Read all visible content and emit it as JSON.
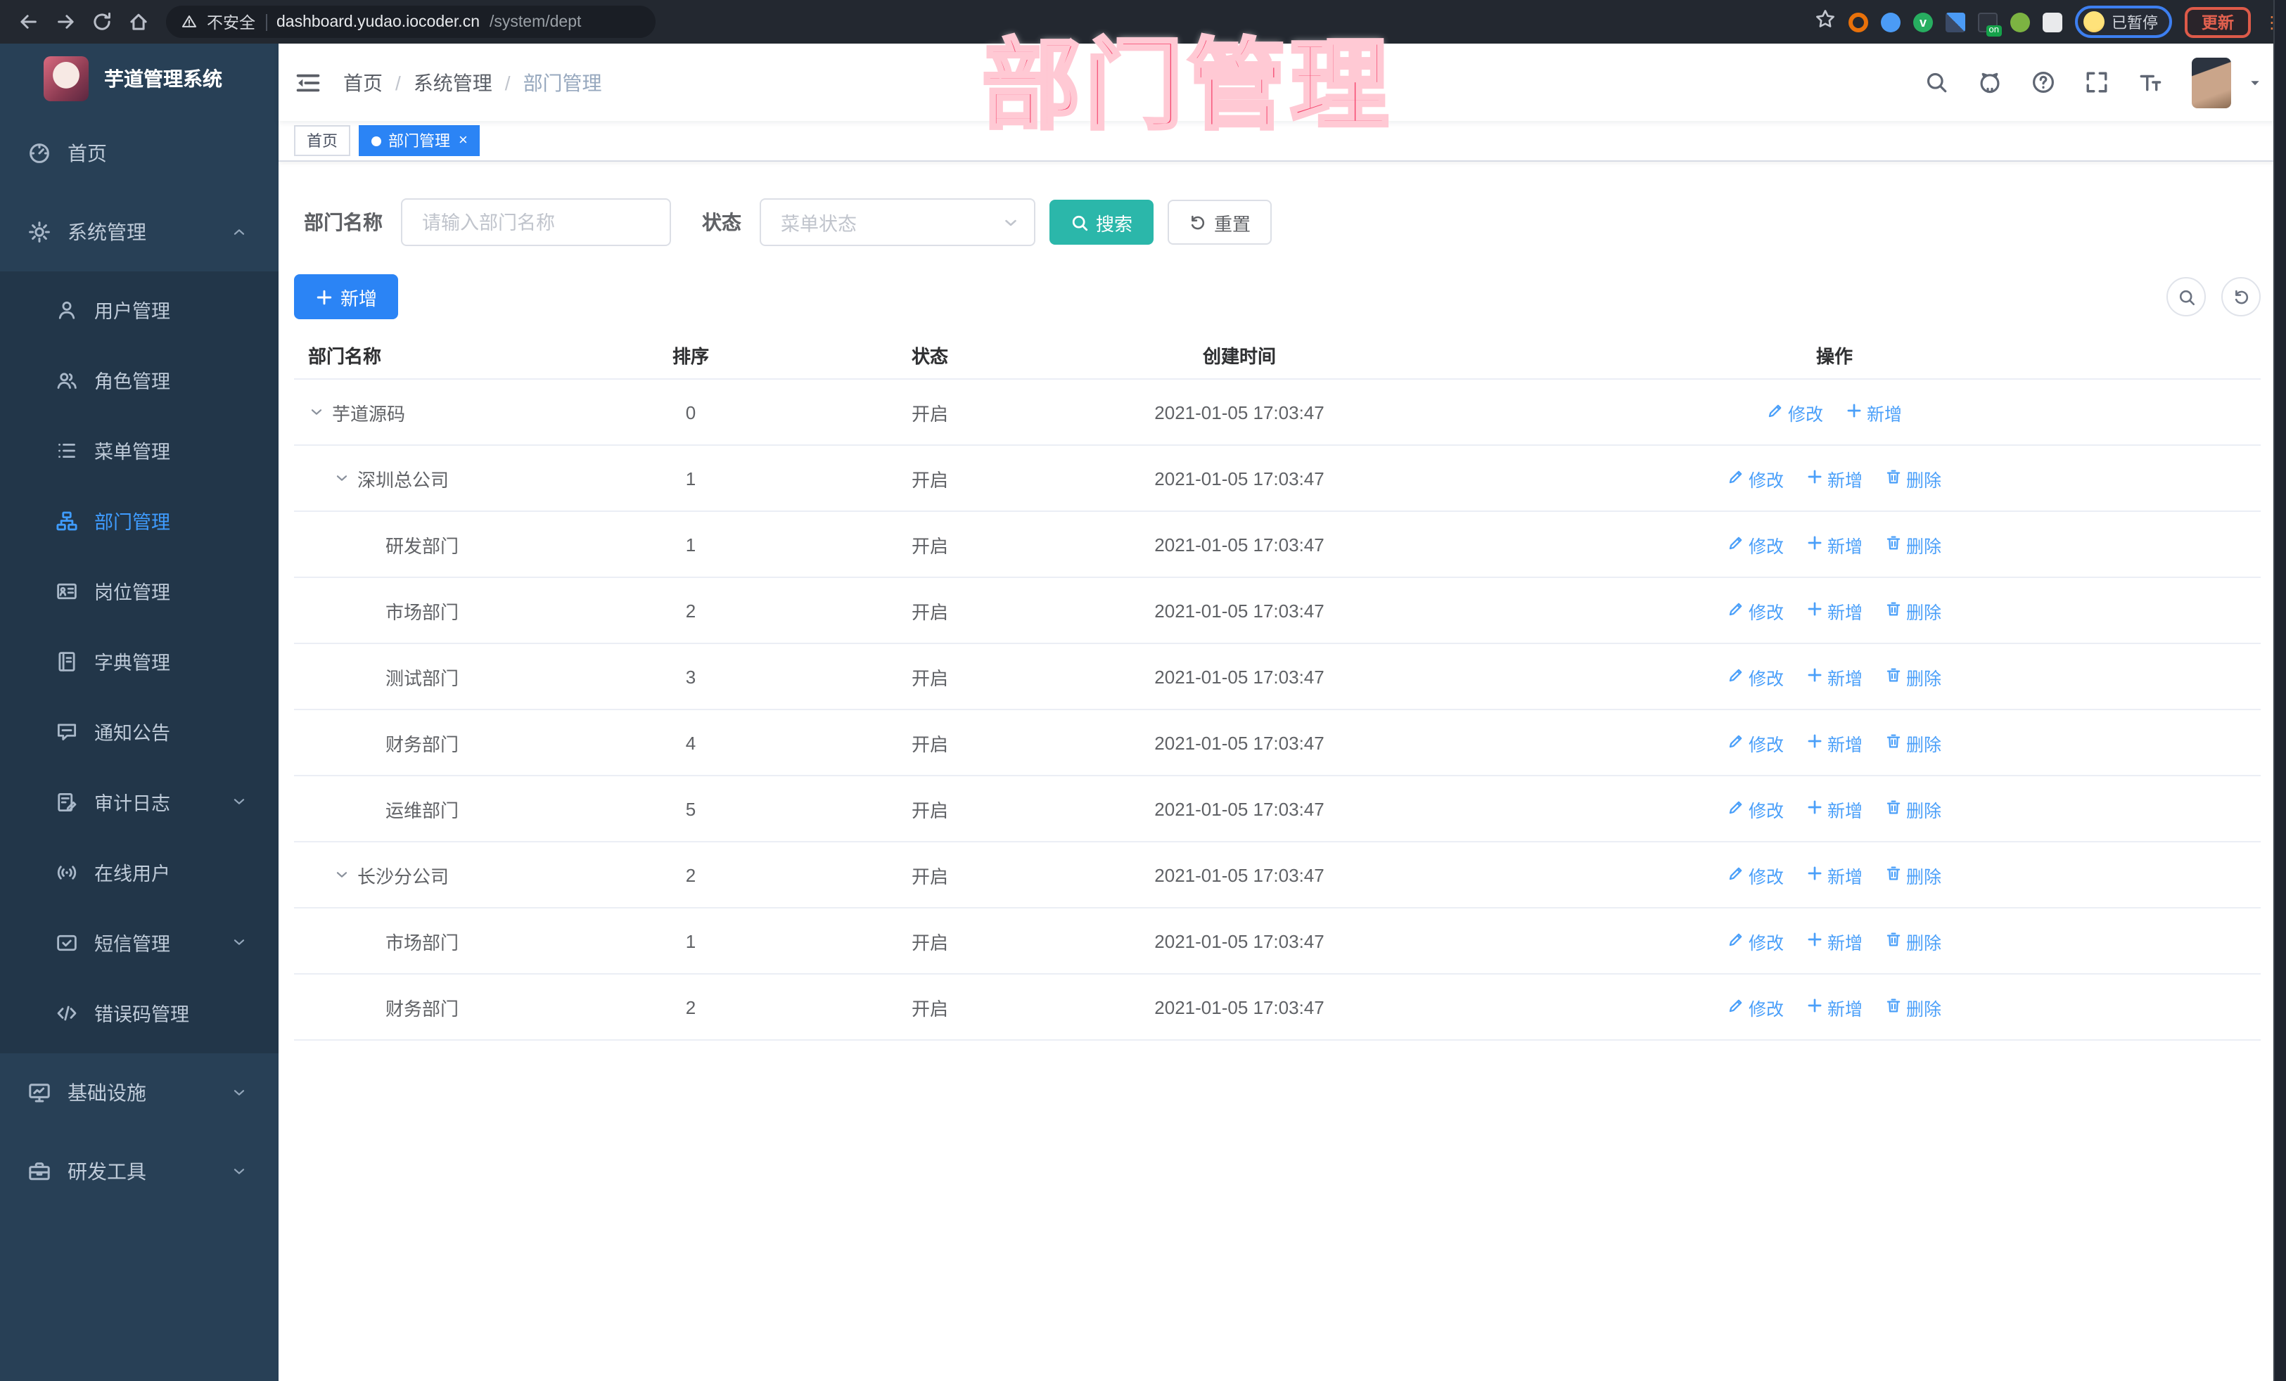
{
  "browser": {
    "security_label": "不安全",
    "url_host": "dashboard.yudao.iocoder.cn",
    "url_path": "/system/dept",
    "ext_badge": "on",
    "profile_status": "已暂停",
    "update_label": "更新"
  },
  "watermark": "部门管理",
  "sidebar": {
    "app_title": "芋道管理系统",
    "items": [
      {
        "label": "首页",
        "icon": "gauge",
        "type": "top"
      },
      {
        "label": "系统管理",
        "icon": "gear",
        "type": "top",
        "chevron": "up",
        "active_parent": true
      },
      {
        "label": "用户管理",
        "icon": "user",
        "type": "sub"
      },
      {
        "label": "角色管理",
        "icon": "users",
        "type": "sub"
      },
      {
        "label": "菜单管理",
        "icon": "menu",
        "type": "sub"
      },
      {
        "label": "部门管理",
        "icon": "org",
        "type": "sub",
        "active": true
      },
      {
        "label": "岗位管理",
        "icon": "idcard",
        "type": "sub"
      },
      {
        "label": "字典管理",
        "icon": "book",
        "type": "sub"
      },
      {
        "label": "通知公告",
        "icon": "bubble",
        "type": "sub"
      },
      {
        "label": "审计日志",
        "icon": "clipboard",
        "type": "sub",
        "chevron": "down"
      },
      {
        "label": "在线用户",
        "icon": "online",
        "type": "sub"
      },
      {
        "label": "短信管理",
        "icon": "message",
        "type": "sub",
        "chevron": "down"
      },
      {
        "label": "错误码管理",
        "icon": "code",
        "type": "sub"
      },
      {
        "label": "基础设施",
        "icon": "monitor",
        "type": "top",
        "chevron": "down"
      },
      {
        "label": "研发工具",
        "icon": "toolbox",
        "type": "top",
        "chevron": "down"
      }
    ]
  },
  "navbar": {
    "breadcrumb": [
      "首页",
      "系统管理",
      "部门管理"
    ]
  },
  "tags": {
    "home": "首页",
    "active": "部门管理"
  },
  "filter": {
    "name_label": "部门名称",
    "name_placeholder": "请输入部门名称",
    "status_label": "状态",
    "status_placeholder": "菜单状态",
    "search_label": "搜索",
    "reset_label": "重置"
  },
  "toolbar": {
    "add_label": "新增"
  },
  "table": {
    "columns": [
      "部门名称",
      "排序",
      "状态",
      "创建时间",
      "操作"
    ],
    "action_labels": {
      "edit": "修改",
      "add": "新增",
      "delete": "删除"
    },
    "rows": [
      {
        "name": "芋道源码",
        "level": 0,
        "expandable": true,
        "sort": "0",
        "status": "开启",
        "time": "2021-01-05 17:03:47",
        "actions": [
          "edit",
          "add"
        ]
      },
      {
        "name": "深圳总公司",
        "level": 1,
        "expandable": true,
        "sort": "1",
        "status": "开启",
        "time": "2021-01-05 17:03:47",
        "actions": [
          "edit",
          "add",
          "delete"
        ]
      },
      {
        "name": "研发部门",
        "level": 2,
        "expandable": false,
        "sort": "1",
        "status": "开启",
        "time": "2021-01-05 17:03:47",
        "actions": [
          "edit",
          "add",
          "delete"
        ]
      },
      {
        "name": "市场部门",
        "level": 2,
        "expandable": false,
        "sort": "2",
        "status": "开启",
        "time": "2021-01-05 17:03:47",
        "actions": [
          "edit",
          "add",
          "delete"
        ]
      },
      {
        "name": "测试部门",
        "level": 2,
        "expandable": false,
        "sort": "3",
        "status": "开启",
        "time": "2021-01-05 17:03:47",
        "actions": [
          "edit",
          "add",
          "delete"
        ]
      },
      {
        "name": "财务部门",
        "level": 2,
        "expandable": false,
        "sort": "4",
        "status": "开启",
        "time": "2021-01-05 17:03:47",
        "actions": [
          "edit",
          "add",
          "delete"
        ]
      },
      {
        "name": "运维部门",
        "level": 2,
        "expandable": false,
        "sort": "5",
        "status": "开启",
        "time": "2021-01-05 17:03:47",
        "actions": [
          "edit",
          "add",
          "delete"
        ]
      },
      {
        "name": "长沙分公司",
        "level": 1,
        "expandable": true,
        "sort": "2",
        "status": "开启",
        "time": "2021-01-05 17:03:47",
        "actions": [
          "edit",
          "add",
          "delete"
        ]
      },
      {
        "name": "市场部门",
        "level": 2,
        "expandable": false,
        "sort": "1",
        "status": "开启",
        "time": "2021-01-05 17:03:47",
        "actions": [
          "edit",
          "add",
          "delete"
        ]
      },
      {
        "name": "财务部门",
        "level": 2,
        "expandable": false,
        "sort": "2",
        "status": "开启",
        "time": "2021-01-05 17:03:47",
        "actions": [
          "edit",
          "add",
          "delete"
        ]
      }
    ]
  }
}
